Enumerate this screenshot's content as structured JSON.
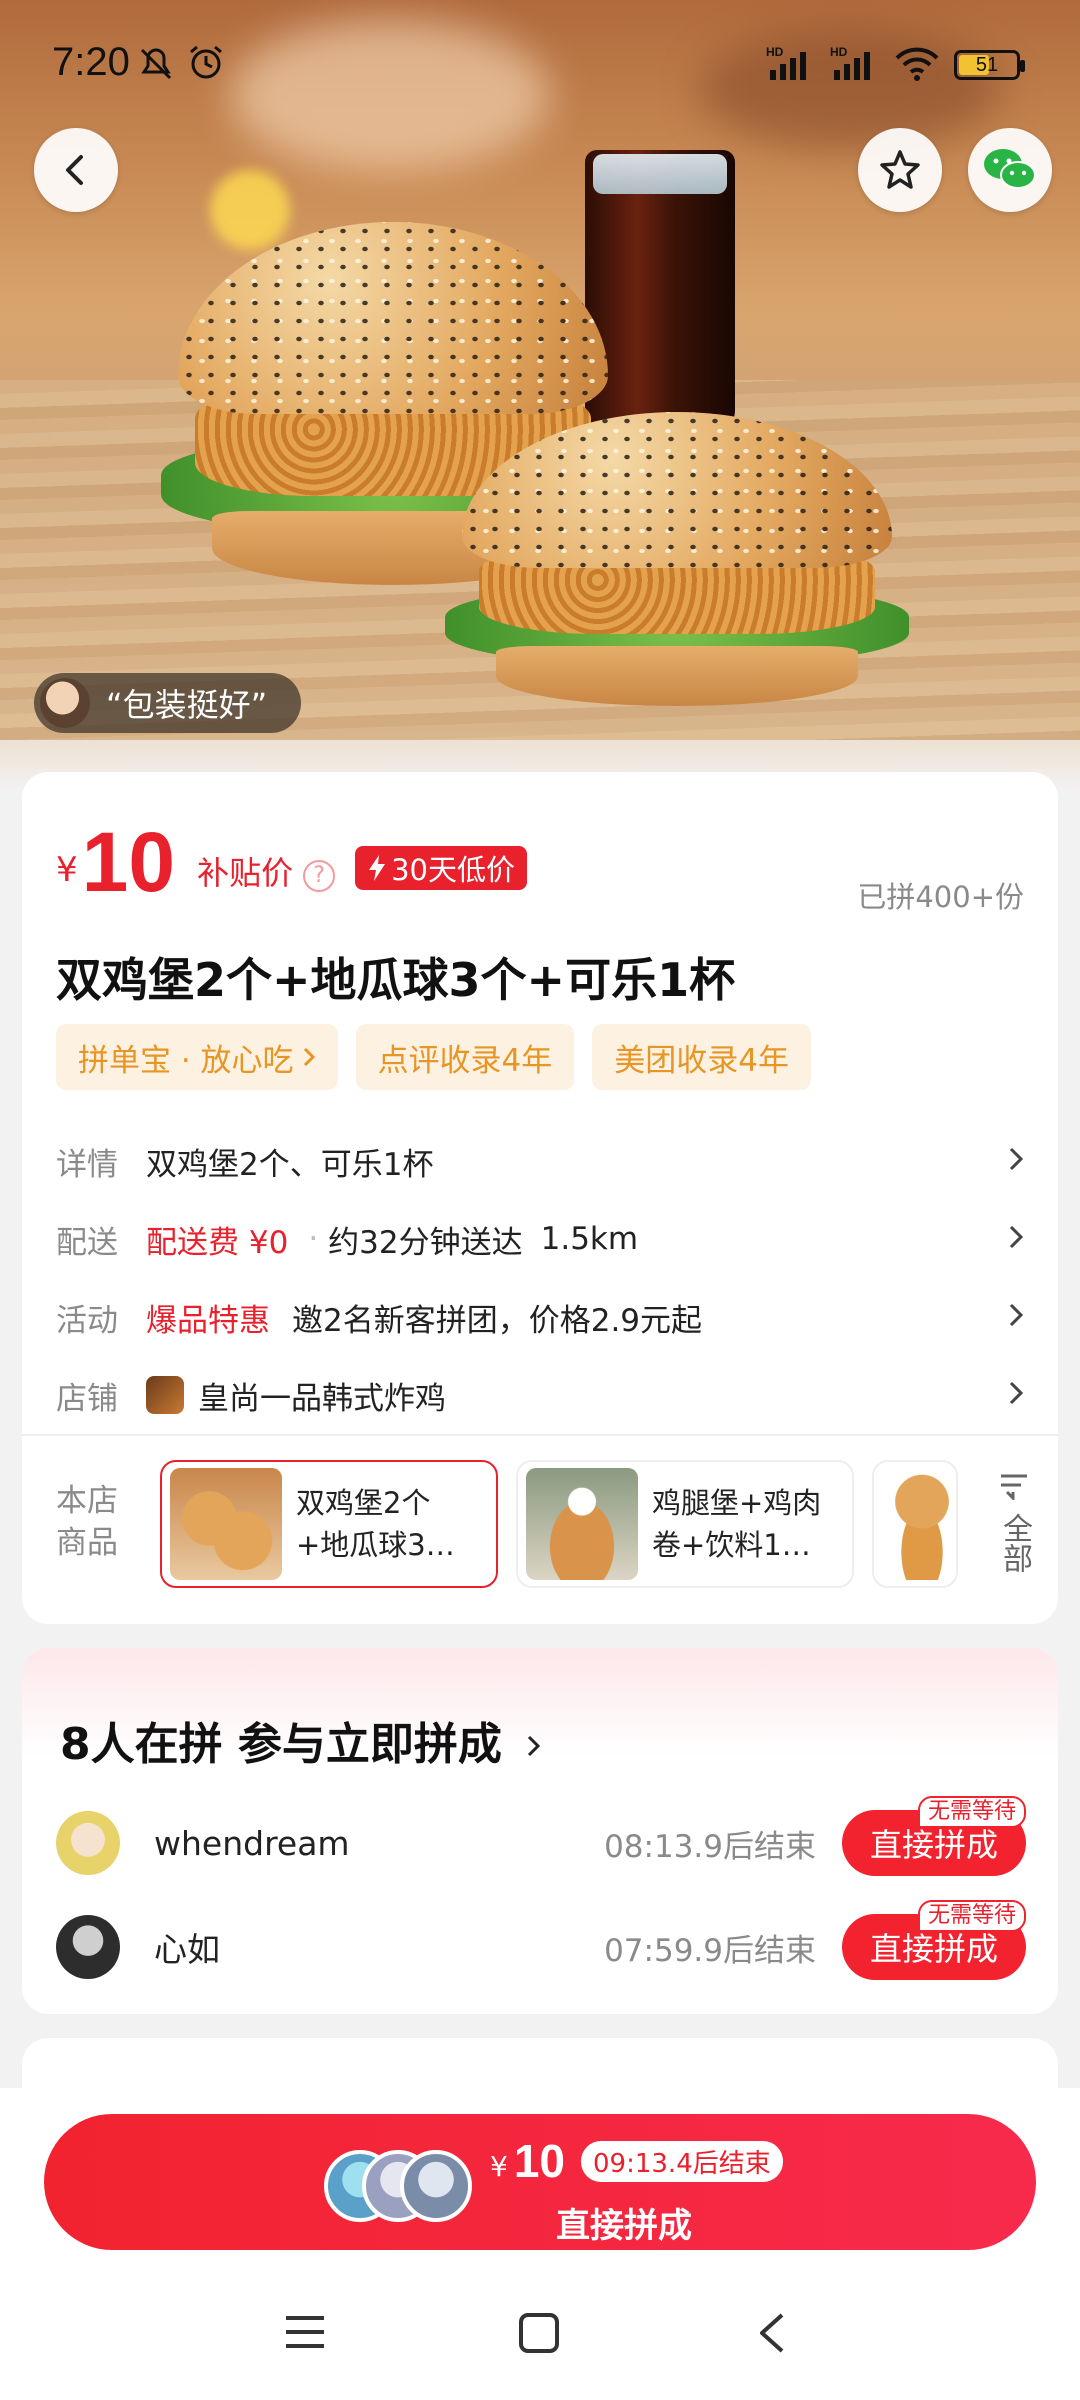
{
  "status_bar": {
    "time": "7:20",
    "battery": "51",
    "network_1": "HD",
    "network_2": "HD"
  },
  "hero": {
    "review_quote": "“包装挺好”"
  },
  "product": {
    "currency": "¥",
    "price": "10",
    "price_label": "补贴价",
    "low_price_badge": "30天低价",
    "sold": "已拼400+份",
    "title": "双鸡堡2个+地瓜球3个+可乐1杯",
    "tags": [
      "拼单宝 · 放心吃",
      "点评收录4年",
      "美团收录4年"
    ]
  },
  "details": {
    "detail_label": "详情",
    "detail_value": "双鸡堡2个、可乐1杯",
    "delivery_label": "配送",
    "delivery_fee": "配送费 ¥0",
    "delivery_time": "约32分钟送达",
    "delivery_distance": "1.5km",
    "activity_label": "活动",
    "activity_tag": "爆品特惠",
    "activity_text": "邀2名新客拼团，价格2.9元起",
    "shop_label": "店铺",
    "shop_name": "皇尚一品韩式炸鸡"
  },
  "store_products": {
    "label": "本店商品",
    "items": [
      {
        "name": "双鸡堡2个+地瓜球3…"
      },
      {
        "name": "鸡腿堡+鸡肉卷+饮料1…"
      }
    ],
    "all_label": "全部"
  },
  "group": {
    "title": "8人在拼 参与立即拼成",
    "no_wait": "无需等待",
    "join_label": "直接拼成",
    "rows": [
      {
        "name": "whendream",
        "timer": "08:13.9后结束"
      },
      {
        "name": "心如",
        "timer": "07:59.9后结束"
      }
    ]
  },
  "cta": {
    "currency": "¥",
    "price": "10",
    "timer": "09:13.4后结束",
    "label": "直接拼成"
  },
  "colors": {
    "accent": "#e8212d",
    "tag_text": "#e79524",
    "tag_bg": "#fdf2e2"
  }
}
